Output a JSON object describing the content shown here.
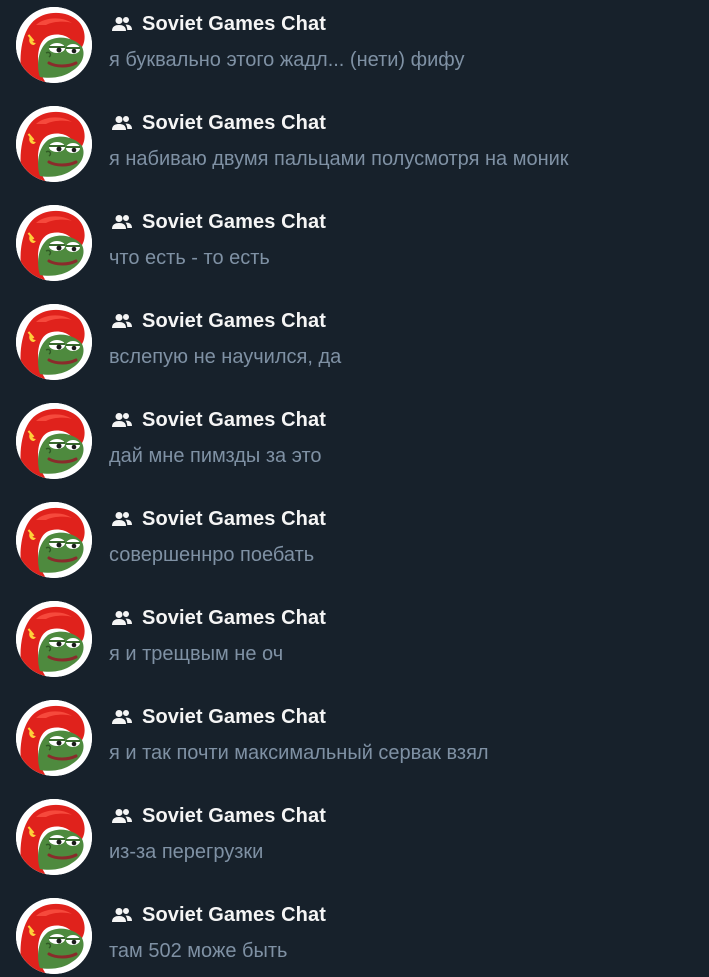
{
  "colors": {
    "background": "#17212b",
    "title": "#f5f5f5",
    "preview": "#7f91a4",
    "avatar_hood": "#e0221c",
    "avatar_face": "#4e8a3e"
  },
  "chats": [
    {
      "title": "Soviet Games Chat",
      "preview": "я буквально этого жадл... (нети) фифу",
      "icon": "group-icon",
      "avatar": "pepe-hood-avatar"
    },
    {
      "title": "Soviet Games Chat",
      "preview": "я набиваю двумя пальцами полусмотря на моник",
      "icon": "group-icon",
      "avatar": "pepe-hood-avatar"
    },
    {
      "title": "Soviet Games Chat",
      "preview": "что есть - то есть",
      "icon": "group-icon",
      "avatar": "pepe-hood-avatar"
    },
    {
      "title": "Soviet Games Chat",
      "preview": "вслепую не научился, да",
      "icon": "group-icon",
      "avatar": "pepe-hood-avatar"
    },
    {
      "title": "Soviet Games Chat",
      "preview": "дай мне пимзды за это",
      "icon": "group-icon",
      "avatar": "pepe-hood-avatar"
    },
    {
      "title": "Soviet Games Chat",
      "preview": "совершеннро поебать",
      "icon": "group-icon",
      "avatar": "pepe-hood-avatar"
    },
    {
      "title": "Soviet Games Chat",
      "preview": "я и трещвым не оч",
      "icon": "group-icon",
      "avatar": "pepe-hood-avatar"
    },
    {
      "title": "Soviet Games Chat",
      "preview": "я и так почти максимальный сервак взял",
      "icon": "group-icon",
      "avatar": "pepe-hood-avatar"
    },
    {
      "title": "Soviet Games Chat",
      "preview": "из-за перегрузки",
      "icon": "group-icon",
      "avatar": "pepe-hood-avatar"
    },
    {
      "title": "Soviet Games Chat",
      "preview": "там 502 може быть",
      "icon": "group-icon",
      "avatar": "pepe-hood-avatar"
    }
  ]
}
